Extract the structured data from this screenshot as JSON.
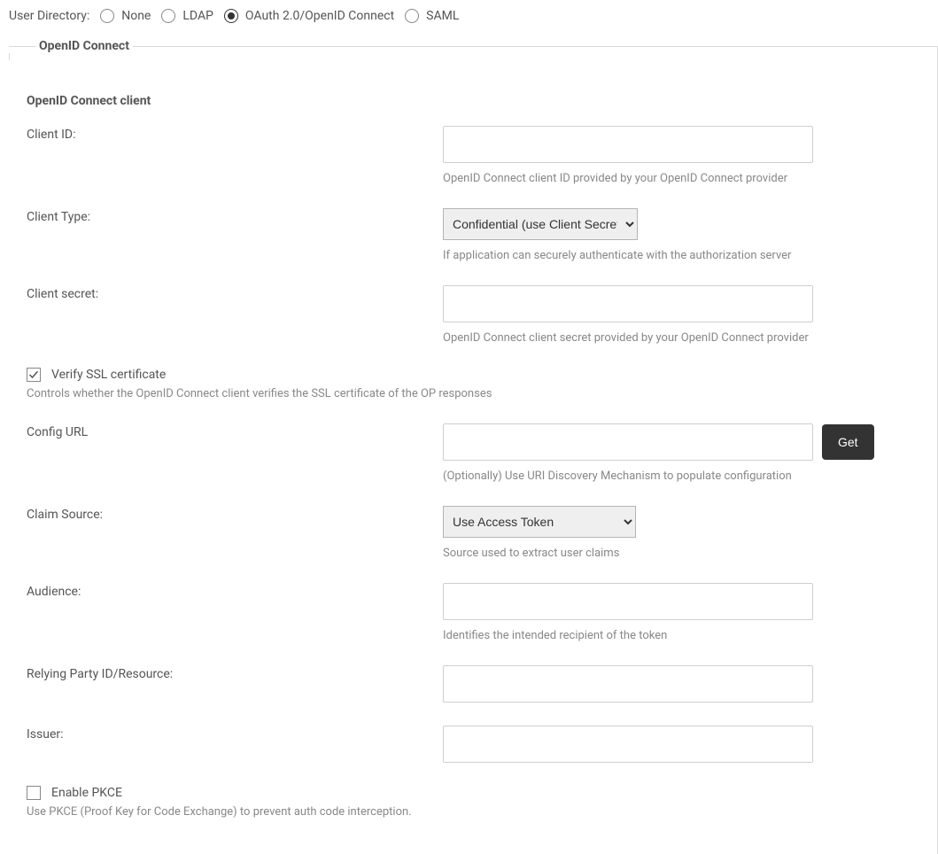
{
  "directory": {
    "label": "User Directory:",
    "options": {
      "none": {
        "label": "None",
        "selected": false
      },
      "ldap": {
        "label": "LDAP",
        "selected": false
      },
      "oidc": {
        "label": "OAuth 2.0/OpenID Connect",
        "selected": true
      },
      "saml": {
        "label": "SAML",
        "selected": false
      }
    }
  },
  "fieldset": {
    "legend": "OpenID Connect"
  },
  "section": {
    "title": "OpenID Connect client"
  },
  "fields": {
    "client_id": {
      "label": "Client ID:",
      "value": "",
      "help": "OpenID Connect client ID provided by your OpenID Connect provider"
    },
    "client_type": {
      "label": "Client Type:",
      "selected": "Confidential (use Client Secret)",
      "help": "If application can securely authenticate with the authorization server"
    },
    "client_secret": {
      "label": "Client secret:",
      "value": "",
      "help": "OpenID Connect client secret provided by your OpenID Connect provider"
    },
    "verify_ssl": {
      "label": "Verify SSL certificate",
      "checked": true,
      "help": "Controls whether the OpenID Connect client verifies the SSL certificate of the OP responses"
    },
    "config_url": {
      "label": "Config URL",
      "value": "",
      "button": "Get",
      "help": "(Optionally) Use URI Discovery Mechanism to populate configuration"
    },
    "claim_source": {
      "label": "Claim Source:",
      "selected": "Use Access Token",
      "help": "Source used to extract user claims"
    },
    "audience": {
      "label": "Audience:",
      "value": "",
      "help": "Identifies the intended recipient of the token"
    },
    "relying_party": {
      "label": "Relying Party ID/Resource:",
      "value": ""
    },
    "issuer": {
      "label": "Issuer:",
      "value": ""
    },
    "enable_pkce": {
      "label": "Enable PKCE",
      "checked": false,
      "help": "Use PKCE (Proof Key for Code Exchange) to prevent auth code interception."
    }
  }
}
